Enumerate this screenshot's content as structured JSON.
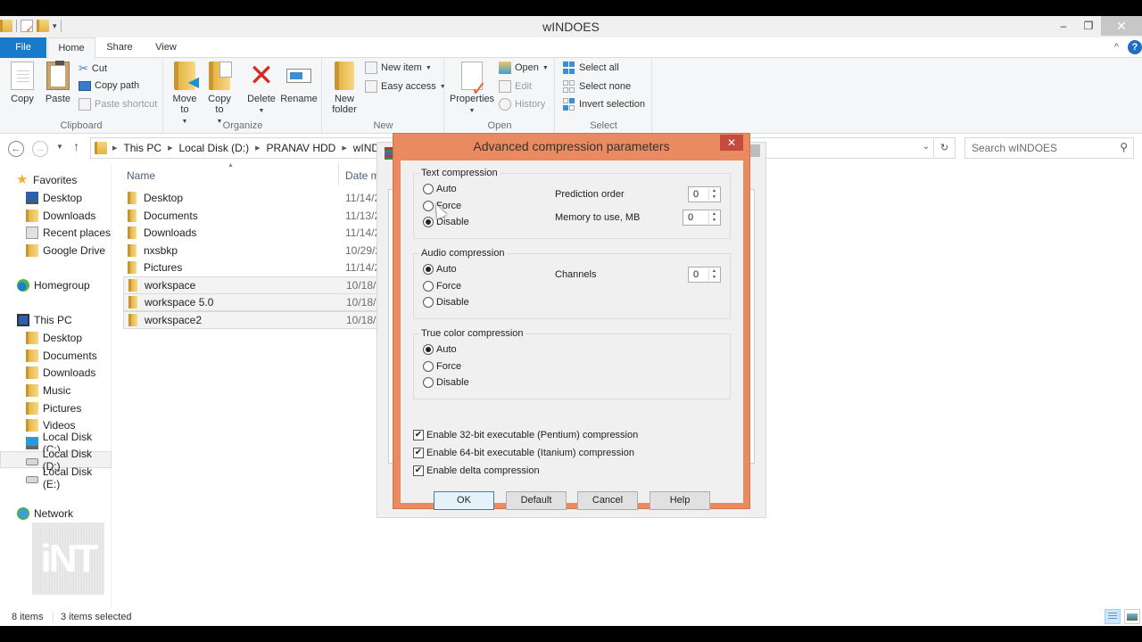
{
  "window": {
    "title": "wINDOES",
    "controls": {
      "minimize": "–",
      "restore": "❐",
      "close": "✕"
    }
  },
  "ribbon": {
    "tabs": [
      {
        "label": "File",
        "active": false
      },
      {
        "label": "Home",
        "active": true
      },
      {
        "label": "Share",
        "active": false
      },
      {
        "label": "View",
        "active": false
      }
    ],
    "groups": {
      "clipboard": {
        "label": "Clipboard",
        "copy": "Copy",
        "paste": "Paste",
        "cut": "Cut",
        "copy_path": "Copy path",
        "paste_shortcut": "Paste shortcut"
      },
      "organize": {
        "label": "Organize",
        "move_to": "Move to",
        "copy_to": "Copy to",
        "delete": "Delete",
        "rename": "Rename"
      },
      "new": {
        "label": "New",
        "new_folder": "New folder",
        "new_item": "New item",
        "easy_access": "Easy access"
      },
      "open": {
        "label": "Open",
        "properties": "Properties",
        "open": "Open",
        "edit": "Edit",
        "history": "History"
      },
      "select": {
        "label": "Select",
        "select_all": "Select all",
        "select_none": "Select none",
        "invert_selection": "Invert selection"
      }
    }
  },
  "address": {
    "breadcrumbs": [
      "This PC",
      "Local Disk (D:)",
      "PRANAV HDD",
      "wINDOE"
    ],
    "search_placeholder": "Search wINDOES"
  },
  "navpane": {
    "favorites": {
      "label": "Favorites",
      "items": [
        "Desktop",
        "Downloads",
        "Recent places",
        "Google Drive"
      ]
    },
    "homegroup": "Homegroup",
    "this_pc": {
      "label": "This PC",
      "items": [
        "Desktop",
        "Documents",
        "Downloads",
        "Music",
        "Pictures",
        "Videos",
        "Local Disk (C:)",
        "Local Disk (D:)",
        "Local Disk (E:)"
      ],
      "selected": "Local Disk (D:)"
    },
    "network": "Network",
    "watermark": "iNT"
  },
  "filelist": {
    "columns": {
      "name": "Name",
      "date": "Date m"
    },
    "rows": [
      {
        "name": "Desktop",
        "date": "11/14/2",
        "selected": false
      },
      {
        "name": "Documents",
        "date": "11/13/2",
        "selected": false
      },
      {
        "name": "Downloads",
        "date": "11/14/2",
        "selected": false
      },
      {
        "name": "nxsbkp",
        "date": "10/29/2",
        "selected": false
      },
      {
        "name": "Pictures",
        "date": "11/14/2",
        "selected": false
      },
      {
        "name": "workspace",
        "date": "10/18/2",
        "selected": true
      },
      {
        "name": "workspace 5.0",
        "date": "10/18/2",
        "selected": true
      },
      {
        "name": "workspace2",
        "date": "10/18/2",
        "selected": true
      }
    ]
  },
  "dialog": {
    "title": "Advanced compression parameters",
    "text_compression": {
      "legend": "Text compression",
      "options": [
        "Auto",
        "Force",
        "Disable"
      ],
      "selected": "Disable",
      "prediction_order_label": "Prediction order",
      "prediction_order": "0",
      "memory_label": "Memory to use, MB",
      "memory": "0"
    },
    "audio_compression": {
      "legend": "Audio compression",
      "options": [
        "Auto",
        "Force",
        "Disable"
      ],
      "selected": "Auto",
      "channels_label": "Channels",
      "channels": "0"
    },
    "true_color_compression": {
      "legend": "True color compression",
      "options": [
        "Auto",
        "Force",
        "Disable"
      ],
      "selected": "Auto"
    },
    "checkboxes": [
      {
        "label": "Enable 32-bit executable (Pentium) compression",
        "checked": true
      },
      {
        "label": "Enable 64-bit executable (Itanium) compression",
        "checked": true
      },
      {
        "label": "Enable delta compression",
        "checked": true
      }
    ],
    "buttons": {
      "ok": "OK",
      "default": "Default",
      "cancel": "Cancel",
      "help": "Help"
    },
    "close": "✕"
  },
  "statusbar": {
    "item_count": "8 items",
    "selected_count": "3 items selected"
  }
}
